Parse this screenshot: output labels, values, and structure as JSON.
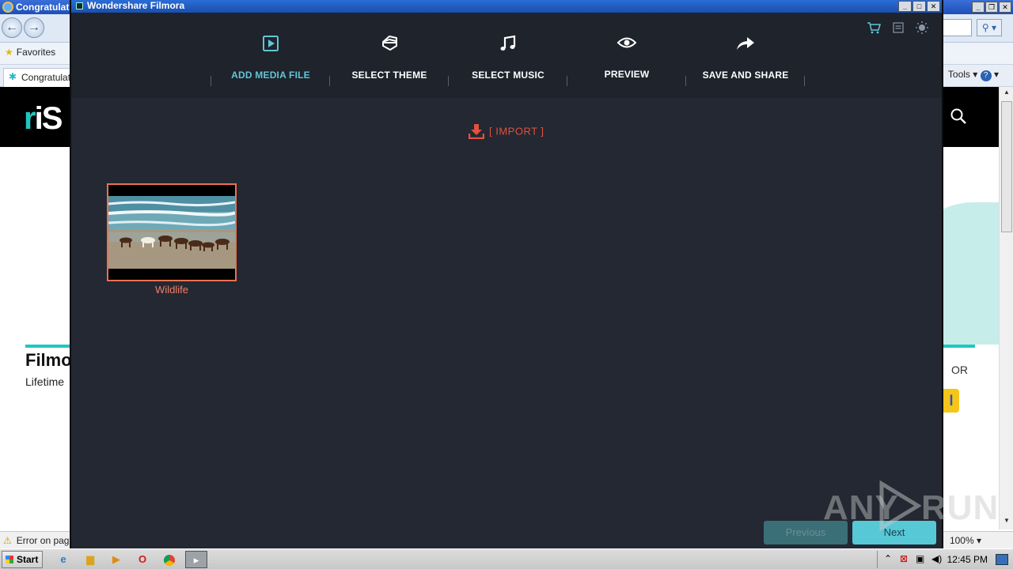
{
  "ie": {
    "title": "Congratulati",
    "favorites_label": "Favorites",
    "tab_label": "Congratulati",
    "tools_label": "Tools ▾",
    "status_text": "Error on page",
    "zoom_text": "100%"
  },
  "website": {
    "logo_text": "iS",
    "heading": "Filmo",
    "subheading": "Lifetime",
    "or_text": "OR",
    "yellow_button_text": "l"
  },
  "filmora": {
    "window_title": "Wondershare Filmora",
    "steps": [
      {
        "label": "ADD MEDIA FILE",
        "icon": "add-media-icon",
        "active": true
      },
      {
        "label": "SELECT THEME",
        "icon": "theme-icon",
        "active": false
      },
      {
        "label": "SELECT MUSIC",
        "icon": "music-note-icon",
        "active": false
      },
      {
        "label": "PREVIEW",
        "icon": "eye-icon",
        "active": false
      },
      {
        "label": "SAVE AND SHARE",
        "icon": "share-arrow-icon",
        "active": false
      }
    ],
    "top_icons": [
      "cart-icon",
      "menu-icon",
      "brightness-icon"
    ],
    "import_label": "[ IMPORT ]",
    "media_items": [
      {
        "name": "Wildlife",
        "selected": true
      }
    ],
    "previous_label": "Previous",
    "next_label": "Next",
    "accent_color": "#63c5d6",
    "import_color": "#e0523e",
    "selection_color": "#f0704f"
  },
  "watermark": {
    "left": "ANY",
    "right": "RUN"
  },
  "taskbar": {
    "start_label": "Start",
    "clock": "12:45 PM"
  }
}
